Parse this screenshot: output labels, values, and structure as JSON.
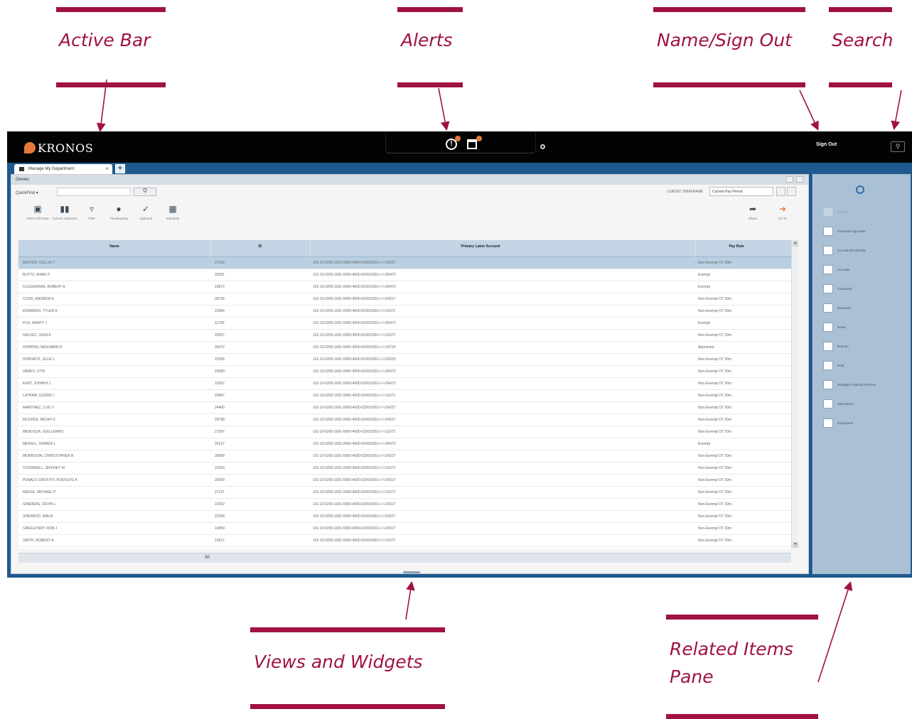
{
  "callouts": {
    "active_bar": "Active Bar",
    "alerts": "Alerts",
    "name_signout": "Name/Sign Out",
    "search": "Search",
    "views_widgets": "Views and Widgets",
    "related_items_line1": "Related Items",
    "related_items_line2": "Pane",
    "color": "#a0123f"
  },
  "app": {
    "logo_text": "KRONOS",
    "signout_label": "Sign Out",
    "brand_colors": {
      "topbar": "#020303",
      "frame": "#1e5a90",
      "accent": "#e5793b"
    }
  },
  "tabs": [
    {
      "label": "Manage My Department",
      "close": "×"
    }
  ],
  "tab_add": "+",
  "panel": {
    "title": "Genies",
    "quickfind": "QuickFind ▾",
    "search_placeholder": "",
    "search_button": "Q",
    "timeframe_label": "LOADED TIMEFRAME",
    "timeframe_value": "Current Pay Period",
    "toolbar": [
      {
        "label": "Select All Rows",
        "icon": "select-all-icon"
      },
      {
        "label": "Column Selection",
        "icon": "columns-icon"
      },
      {
        "label": "Filter",
        "icon": "filter-icon"
      },
      {
        "label": "Timekeeping",
        "icon": "timekeeping-icon"
      },
      {
        "label": "Approval",
        "icon": "approval-icon"
      },
      {
        "label": "Schedule",
        "icon": "schedule-icon"
      }
    ],
    "share_label": "Share",
    "goto_label": "Go To"
  },
  "table": {
    "columns": [
      "Name",
      "ID",
      "Primary Labor Account",
      "Pay Rule"
    ],
    "rows": [
      [
        "BAXTER, COLLIN T",
        "27135",
        "101-10-0200-1001-0000-4000-0200/1001/-/-/-/24227",
        "Non-Exempt OT 30m"
      ],
      [
        "BUTTS, MARK P",
        "25081",
        "101-10-0200-1001-0000-4000-0200/1001/-/-/-/26472",
        "Exempt"
      ],
      [
        "CLEGERMAN, ROBERT A",
        "10872",
        "101-10-0200-1001-0000-4000-0200/1001/-/-/-/26472",
        "Exempt"
      ],
      [
        "COOK, ANDREW A",
        "06736",
        "101-10-0200-1001-0000-4000-0200/1001/-/-/-/24227",
        "Non-Exempt OT 30m"
      ],
      [
        "EDWARDS, TYLER A",
        "23084",
        "101-10-0200-1001-0000-4000-0200/1001/-/-/-/11072",
        "Non-Exempt OT 30m"
      ],
      [
        "FOX, MARTY J",
        "11790",
        "101-10-0200-1001-0000-4000-0200/1001/-/-/-/26472",
        "Exempt"
      ],
      [
        "GALVEZ, JUAN A",
        "26357",
        "101-10-0200-1001-0000-4000-0200/1001/-/-/-/11072",
        "Non-Exempt OT 30m"
      ],
      [
        "HOPKINS, BENJAMIN R",
        "26472",
        "101-10-0200-1001-0000-4000-0200/1001/-/-/-/19726",
        "Appointed"
      ],
      [
        "HORVACH, JULIE L",
        "22385",
        "101-10-0200-1001-0000-4000-0200/1001/-/-/-/23030",
        "Non-Exempt OT 30m"
      ],
      [
        "JAMES, OTIS",
        "23080",
        "101-10-0200-1001-0000-4000-0200/1001/-/-/-/26472",
        "Non-Exempt OT 30m"
      ],
      [
        "KENT, JOHNNY L",
        "19287",
        "101-10-0200-1001-0000-4000-0200/1001/-/-/-/26472",
        "Non-Exempt OT 30m"
      ],
      [
        "LATHAM, CEDRIC I",
        "20887",
        "101-10-0200-1001-0000-4000-0200/1001/-/-/-/11072",
        "Non-Exempt OT 30m"
      ],
      [
        "MARTINEZ, LUIS V",
        "24400",
        "101-10-0200-1001-0000-4000-0200/1001/-/-/-/24227",
        "Non-Exempt OT 30m"
      ],
      [
        "MCGHEE, MICAH S",
        "20798",
        "101-10-0200-1001-0000-4000-0200/1001/-/-/-/24227",
        "Non-Exempt OT 30m"
      ],
      [
        "MENDOZA, GUILLERMO",
        "27287",
        "101-10-0200-1001-0000-4000-0200/1001/-/-/-/11072",
        "Non-Exempt OT 30m"
      ],
      [
        "MERALL, DAMIEN L",
        "24127",
        "101-10-0200-1001-0000-4000-0200/1001/-/-/-/26472",
        "Exempt"
      ],
      [
        "MORRISON, CHRISTOPHER B",
        "26989",
        "101-10-0200-1001-0000-4000-0200/1001/-/-/-/24227",
        "Non-Exempt OT 30m"
      ],
      [
        "O'DONNELL, JEFFREY M",
        "22300",
        "101-10-0200-1001-0000-4000-0200/1001/-/-/-/11072",
        "Non-Exempt OT 30m"
      ],
      [
        "PENALO GRIFFITH, RODOLFO A",
        "26599",
        "101-10-0200-1001-0000-4000-0200/1001/-/-/-/24227",
        "Non-Exempt OT 30m"
      ],
      [
        "REESE, MICHAEL P",
        "27121",
        "101-10-0200-1001-0000-4000-0200/1001/-/-/-/11072",
        "Non-Exempt OT 30m"
      ],
      [
        "SANDERS, DEVIN L",
        "23302",
        "101-10-0200-1001-0000-4000-0200/1001/-/-/-/24227",
        "Non-Exempt OT 30m"
      ],
      [
        "SHERROD, MALIK",
        "22280",
        "101-10-0200-1001-0000-4000-0200/1001/-/-/-/24227",
        "Non-Exempt OT 30m"
      ],
      [
        "SINGLETARY, RON J",
        "14859",
        "101-10-0200-1001-0000-4000-0200/1001/-/-/-/24227",
        "Non-Exempt OT 30m"
      ],
      [
        "SMITH, ROBERT A",
        "10527",
        "101-10-0200-1001-0000-4000-0200/1001/-/-/-/11072",
        "Non-Exempt OT 30m"
      ]
    ],
    "footer_count": "30"
  },
  "related": {
    "items": [
      {
        "label": "Genies",
        "disabled": true
      },
      {
        "label": "Timecard Approvals",
        "disabled": false
      },
      {
        "label": "Accrual Info Results",
        "disabled": false
      },
      {
        "label": "Accruals",
        "disabled": false
      },
      {
        "label": "Timecards",
        "disabled": false
      },
      {
        "label": "Requests",
        "disabled": false
      },
      {
        "label": "Notes",
        "disabled": false
      },
      {
        "label": "Reports",
        "disabled": false
      },
      {
        "label": "Help",
        "disabled": false
      },
      {
        "label": "Delegate Authority Persons",
        "disabled": false
      },
      {
        "label": "Attendance",
        "disabled": false
      },
      {
        "label": "Exceptions",
        "disabled": false
      }
    ]
  }
}
